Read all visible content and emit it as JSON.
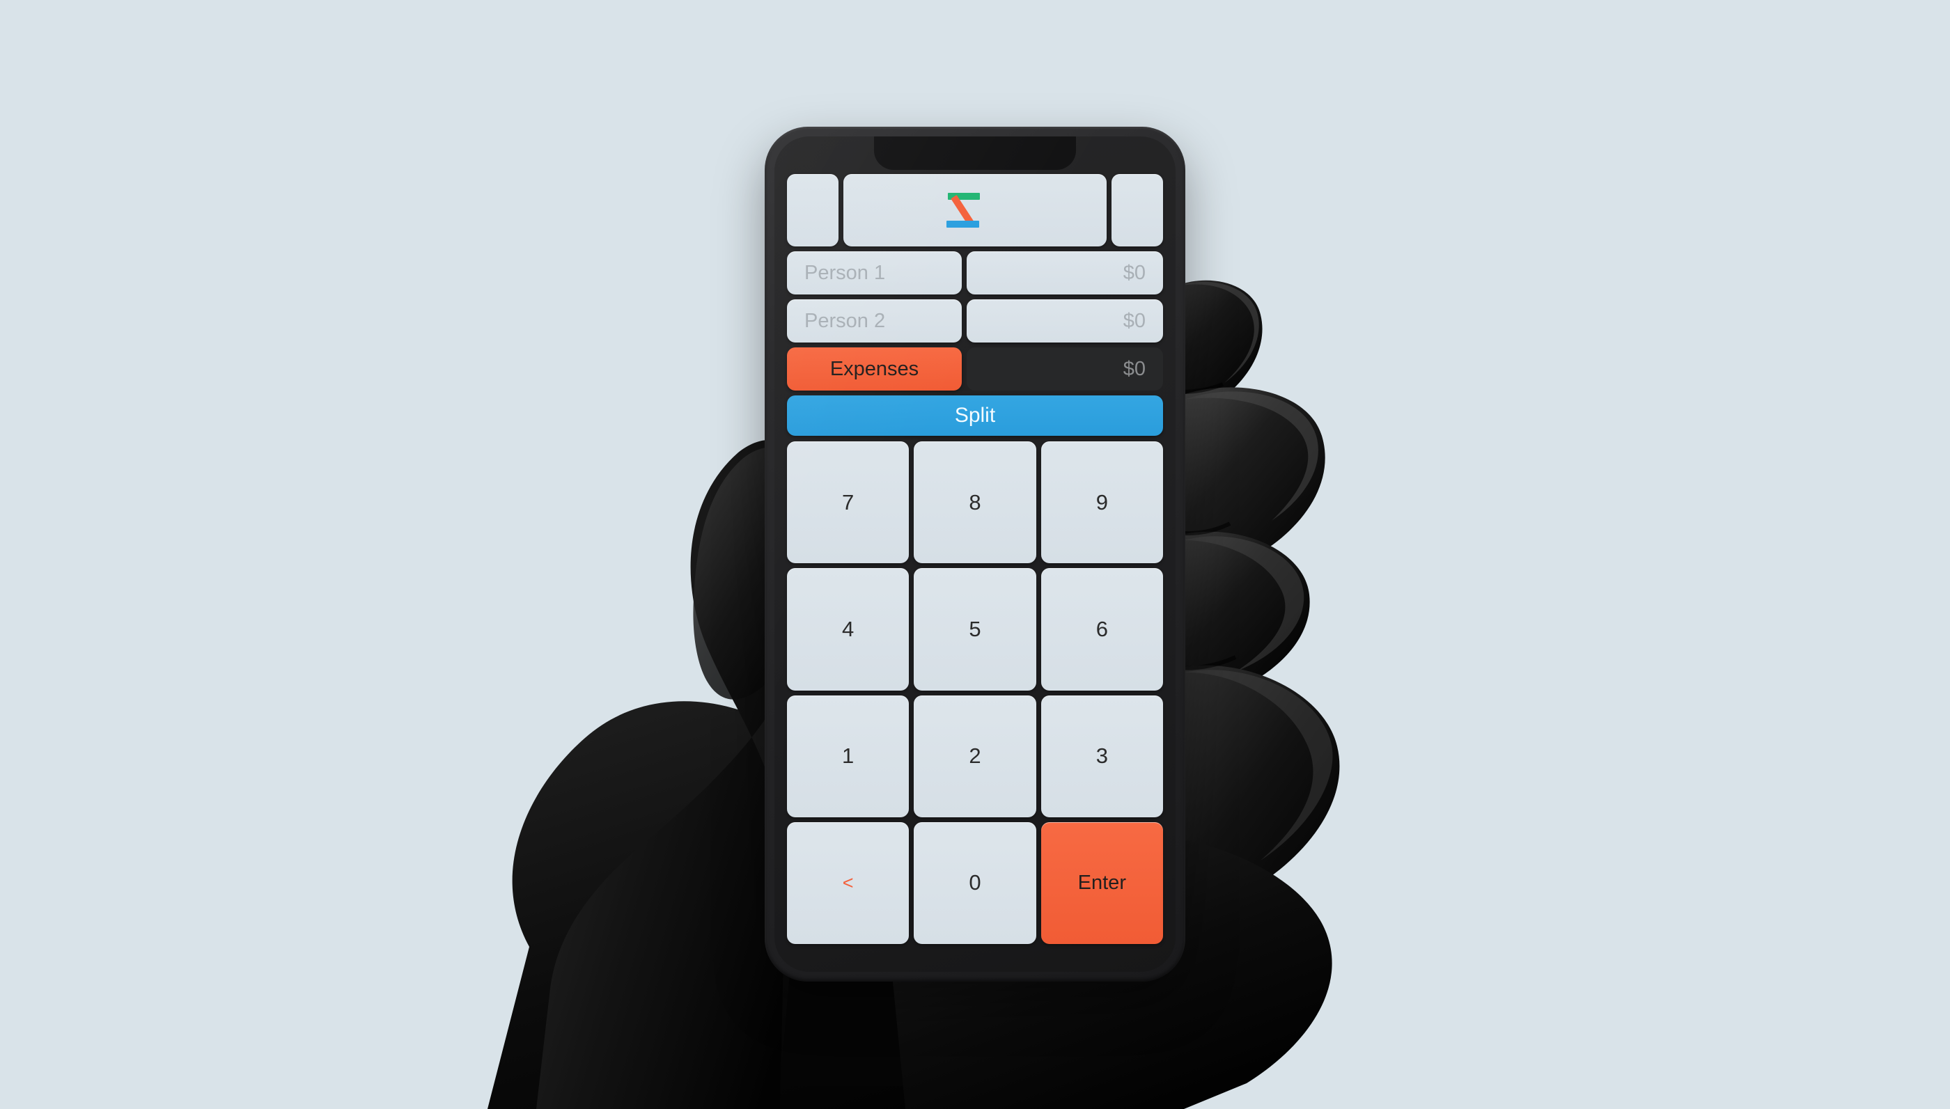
{
  "app": {
    "name": "Split",
    "background_color": "#d9e3e9",
    "accent_orange": "#f4613c",
    "accent_blue": "#2a9fdf",
    "accent_green": "#22b573",
    "tile_color": "#dde5eb",
    "dark_field_color": "#272829"
  },
  "header": {
    "left_panel_label": "",
    "right_panel_label": "",
    "logo": {
      "name": "split-logo",
      "top_bar_color": "#22b573",
      "diagonal_bar_color": "#f4613c",
      "bottom_bar_color": "#2a9fdf"
    }
  },
  "people": [
    {
      "name_placeholder": "Person 1",
      "amount": "$0"
    },
    {
      "name_placeholder": "Person 2",
      "amount": "$0"
    }
  ],
  "expenses": {
    "label": "Expenses",
    "amount": "$0"
  },
  "split": {
    "label": "Split"
  },
  "keypad": {
    "rows": [
      [
        {
          "label": "7",
          "type": "digit"
        },
        {
          "label": "8",
          "type": "digit"
        },
        {
          "label": "9",
          "type": "digit"
        }
      ],
      [
        {
          "label": "4",
          "type": "digit"
        },
        {
          "label": "5",
          "type": "digit"
        },
        {
          "label": "6",
          "type": "digit"
        }
      ],
      [
        {
          "label": "1",
          "type": "digit"
        },
        {
          "label": "2",
          "type": "digit"
        },
        {
          "label": "3",
          "type": "digit"
        }
      ],
      [
        {
          "label": "<",
          "type": "backspace"
        },
        {
          "label": "0",
          "type": "digit"
        },
        {
          "label": "Enter",
          "type": "enter"
        }
      ]
    ]
  }
}
